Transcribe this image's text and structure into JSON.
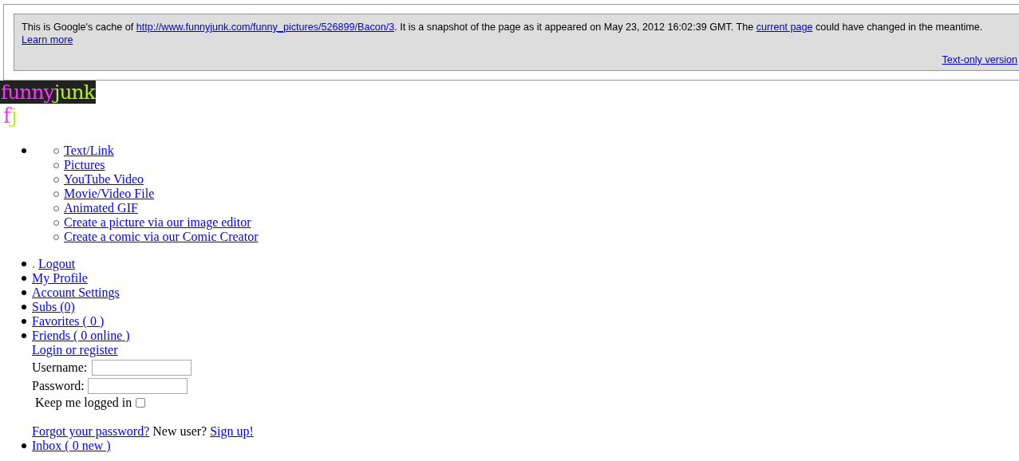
{
  "cache_notice": {
    "text_before": "This is Google's cache of ",
    "url": "http://www.funnyjunk.com/funny_pictures/526899/Bacon/3",
    "text_middle": ". It is a snapshot of the page as it appeared on May 23, 2012 16:02:39 GMT. The ",
    "current_page_link": "current page",
    "text_after": " could have changed in the meantime. ",
    "learn_more": "Learn more",
    "text_only_link": "Text-only version"
  },
  "logo": {
    "first": "funny",
    "second": "junk"
  },
  "small_logo": {
    "first": "f",
    "second": "j"
  },
  "upload_menu": [
    {
      "label": "Text/Link"
    },
    {
      "label": "Pictures"
    },
    {
      "label": "YouTube Video"
    },
    {
      "label": "Movie/Video File"
    },
    {
      "label": "Animated GIF"
    },
    {
      "label": "Create a picture via our image editor"
    },
    {
      "label": "Create a comic via our Comic Creator"
    }
  ],
  "user_menu": [
    {
      "kind": "prefixed",
      "prefix": ".",
      "label": "Logout"
    },
    {
      "kind": "link",
      "label": "My Profile"
    },
    {
      "kind": "link",
      "label": "Account Settings"
    },
    {
      "kind": "link",
      "label": "Subs (0)"
    },
    {
      "kind": "link",
      "label": "Favorites ( 0 )"
    },
    {
      "kind": "link",
      "label": "Friends ( 0 online )"
    }
  ],
  "login": {
    "title": "Login or register",
    "username_label": "Username:",
    "password_label": "Password:",
    "keep_label": "Keep me logged in",
    "keep_checked": false,
    "forgot": "Forgot your password?",
    "new_user": "New user?",
    "sign_up": "Sign up!"
  },
  "inbox": {
    "label": "Inbox ( 0 new )"
  }
}
